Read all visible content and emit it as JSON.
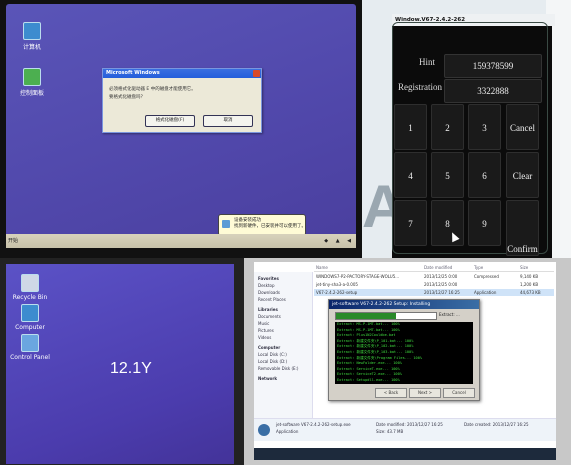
{
  "panel1": {
    "desktop_icons": [
      {
        "label": "计算机",
        "icon": "computer-icon"
      },
      {
        "label": "控制面板",
        "icon": "control-panel-icon"
      }
    ],
    "dialog": {
      "title": "Microsoft Windows",
      "lines": [
        "必须格式化驱动器 E 中的磁盘才能使用它。",
        "要格式化磁盘吗？"
      ],
      "button_primary": "格式化磁盘(F)",
      "button_secondary": "取消"
    },
    "taskbar": {
      "start_label": "开始",
      "tray_icons": [
        "shield-icon",
        "network-icon",
        "volume-icon"
      ]
    },
    "balloon": {
      "line1": "设备安装成功",
      "line2": "找到新硬件，已安装并可以使用了。"
    }
  },
  "panel2": {
    "title": "Window.V67-2.4.2-262",
    "hint_label": "Hint",
    "hint_value": "159378599",
    "registration_label": "Registration",
    "registration_value": "3322888",
    "keys": [
      "1",
      "2",
      "3",
      "Cancel",
      "4",
      "5",
      "6",
      "Clear",
      "7",
      "8",
      "9",
      "Confirm"
    ],
    "background_letter": "A"
  },
  "panel3": {
    "desktop_icons": [
      {
        "label": "Recycle Bin",
        "icon": "recycle-bin-icon"
      },
      {
        "label": "Computer",
        "icon": "computer-icon"
      },
      {
        "label": "Control Panel",
        "icon": "control-panel-icon"
      }
    ],
    "center_text": "12.1Y"
  },
  "panel4": {
    "sidebar": [
      "Favorites",
      "Desktop",
      "Downloads",
      "Recent Places",
      "Libraries",
      "Documents",
      "Music",
      "Pictures",
      "Videos",
      "Computer",
      "Local Disk (C:)",
      "Local Disk (D:)",
      "Removable Disk (E:)",
      "Network"
    ],
    "sidebar_headers": [
      "Favorites",
      "Libraries",
      "Computer",
      "Network"
    ],
    "file_headers": {
      "name": "Name",
      "date": "Date modified",
      "type": "Type",
      "size": "Size"
    },
    "files": [
      {
        "name": "WINDOWS7-P2-PACTORY-STAGE-WOLU5...",
        "date": "2013/12/25 0:00",
        "type": "Compressed",
        "size": "9,140 KB"
      },
      {
        "name": "jet-tiny-sha3-a-0.005",
        "date": "2013/12/25 0:00",
        "type": "",
        "size": "1,200 KB"
      },
      {
        "name": "V67-2.4.2-262-setup",
        "date": "2013/12/27 16:25",
        "type": "Application",
        "size": "44,673 KB"
      }
    ],
    "setup": {
      "title": "jet-software V67-2.4.2-262 Setup: Installing",
      "progress_label": "Extract: ...",
      "progress_fraction": 0.6,
      "log": [
        "Extract: MS-P-1MT.bat... 100%",
        "Extract: MS-P-1MT.bat... 100%",
        "Extract: Plus1N2Couldbe.bat",
        "Extract: 新建文件夹\\P_101.bat... 100%",
        "Extract: 新建文件夹\\P_102.bat... 100%",
        "Extract: 新建文件夹\\P_103.bat... 100%",
        "Extract: 新建文件夹\\Program Files... 100%",
        "Extract: NewFolder.exe... 100%",
        "Extract: ServiceT.exe... 100%",
        "Extract: ServiceT2.exe... 100%",
        "Extract: Setupdll.exe... 100%"
      ],
      "btn_back": "< Back",
      "btn_next": "Next >",
      "btn_cancel": "Cancel"
    },
    "details": {
      "name": "jet-software V67-2.4.2-262-setup.exe",
      "modified": "Date modified: 2013/12/27 16:25",
      "type": "Application",
      "size": "Size: 43.7 MB",
      "created": "Date created: 2013/12/27 16:25"
    }
  }
}
